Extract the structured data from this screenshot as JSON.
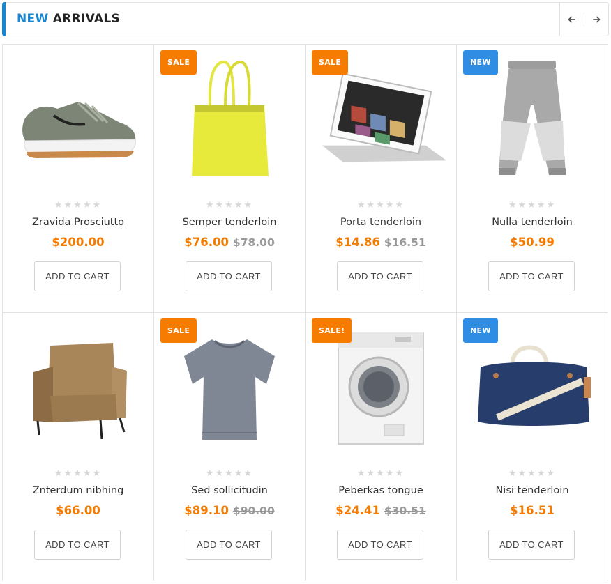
{
  "header": {
    "title_part1": "NEW",
    "title_part2": "ARRIVALS",
    "prev_icon": "arrow-left-icon",
    "next_icon": "arrow-right-icon",
    "accent_color": "#1a86d0"
  },
  "colors": {
    "price": "#f57c00",
    "sale_badge": "#f57c00",
    "new_badge": "#2f8de4",
    "old_price": "#999999"
  },
  "products": [
    {
      "name": "Zravida Prosciutto",
      "price": "$200.00",
      "old_price": "",
      "badge": "",
      "rating": 0,
      "button": "ADD TO CART",
      "image": "sneaker-image"
    },
    {
      "name": "Semper tenderloin",
      "price": "$76.00",
      "old_price": "$78.00",
      "badge": "SALE",
      "rating": 0,
      "button": "ADD TO CART",
      "image": "tote-bag-image"
    },
    {
      "name": "Porta tenderloin",
      "price": "$14.86",
      "old_price": "$16.51",
      "badge": "SALE",
      "rating": 0,
      "button": "ADD TO CART",
      "image": "tablet-image"
    },
    {
      "name": "Nulla tenderloin",
      "price": "$50.99",
      "old_price": "",
      "badge": "NEW",
      "rating": 0,
      "button": "ADD TO CART",
      "image": "sweatpants-image"
    },
    {
      "name": "Znterdum nibhing",
      "price": "$66.00",
      "old_price": "",
      "badge": "",
      "rating": 0,
      "button": "ADD TO CART",
      "image": "armchair-image"
    },
    {
      "name": "Sed sollicitudin",
      "price": "$89.10",
      "old_price": "$90.00",
      "badge": "SALE",
      "rating": 0,
      "button": "ADD TO CART",
      "image": "tshirt-image"
    },
    {
      "name": "Peberkas tongue",
      "price": "$24.41",
      "old_price": "$30.51",
      "badge": "SALE!",
      "rating": 0,
      "button": "ADD TO CART",
      "image": "washing-machine-image"
    },
    {
      "name": "Nisi tenderloin",
      "price": "$16.51",
      "old_price": "",
      "badge": "NEW",
      "rating": 0,
      "button": "ADD TO CART",
      "image": "duffel-bag-image"
    }
  ]
}
